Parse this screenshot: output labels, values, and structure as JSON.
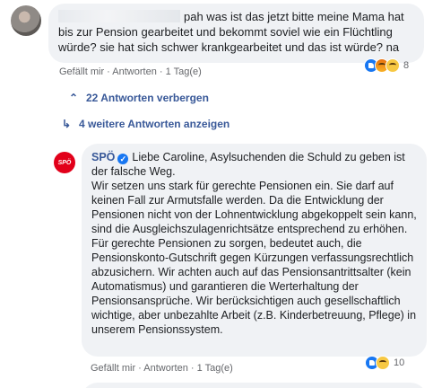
{
  "comment1": {
    "text": "pah was ist das jetzt bitte meine Mama hat bis zur Pension gearbeitet und bekommt soviel wie ein Flüchtling würde? sie hat sich schwer krankgearbeitet und das ist würde? na",
    "actions": {
      "like": "Gefällt mir",
      "sep1": " · ",
      "reply": "Antworten",
      "sep2": " · ",
      "time": "1 Tag(e)"
    },
    "reactions": {
      "icons": [
        "like-icon",
        "angry-icon",
        "haha-icon"
      ],
      "count": "8"
    }
  },
  "thread": {
    "hide_replies": "22 Antworten verbergen",
    "show_more": "4 weitere Antworten anzeigen"
  },
  "comment2": {
    "author": "SPÖ",
    "logo_text": "SPÖ",
    "intro": "Liebe Caroline, Asylsuchenden die Schuld zu geben ist der falsche Weg.",
    "body": "Wir setzen uns stark für gerechte Pensionen ein. Sie darf auf keinen Fall zur Armutsfalle werden. Da die Entwicklung der Pensionen nicht von der Lohnentwicklung abgekoppelt sein kann, sind die Ausgleichszulagenrichtsätze entsprechend zu erhöhen. Für gerechte Pensionen zu sorgen, bedeutet auch, die Pensionskonto-Gutschrift gegen Kürzungen verfassungsrechtlich abzusichern. Wir achten auch auf das Pensionsantrittsalter (kein Automatismus) und garantieren die Werterhaltung der Pensionsansprüche. Wir berücksichtigen auch gesellschaftlich wichtige, aber unbezahlte Arbeit (z.B. Kinderbetreuung, Pflege) in unserem Pensionssystem.",
    "actions": {
      "like": "Gefällt mir",
      "sep1": " · ",
      "reply": "Antworten",
      "sep2": " · ",
      "time": "1 Tag(e)"
    },
    "reactions": {
      "icons": [
        "like-icon",
        "haha-icon"
      ],
      "count": "10"
    }
  },
  "colors": {
    "link": "#385898",
    "bubble": "#f0f2f5",
    "brand_red": "#e2001a",
    "like_blue": "#1877f2"
  }
}
